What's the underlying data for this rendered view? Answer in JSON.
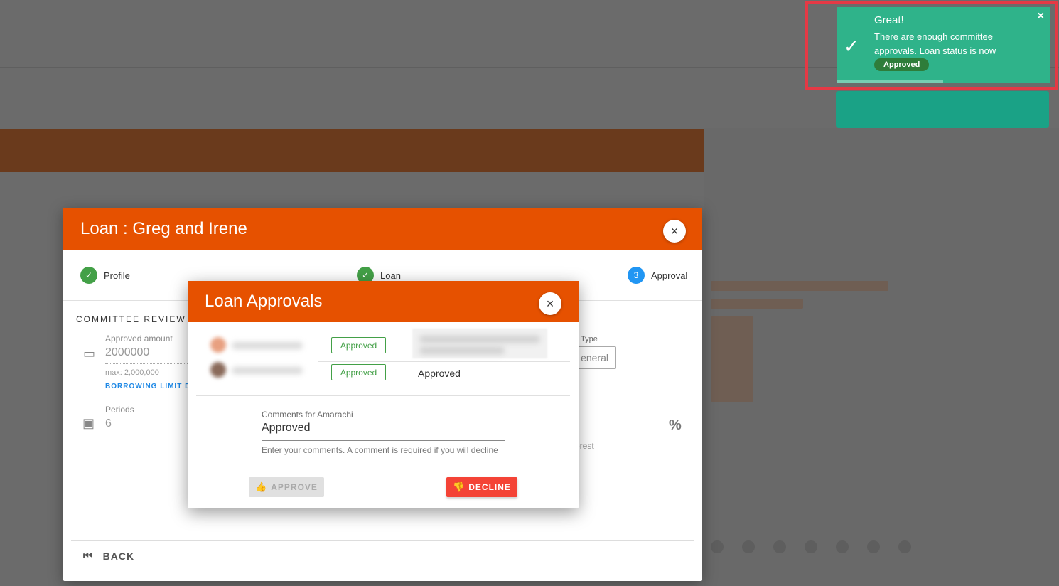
{
  "toast": {
    "title": "Great!",
    "message": "There are enough committee approvals. Loan status is now",
    "badge": "Approved",
    "close_icon": "×",
    "check_icon": "✓",
    "color": "#2fb38a"
  },
  "loan_modal": {
    "title": "Loan : Greg and Irene",
    "close_icon": "×",
    "steps": [
      {
        "label": "Profile",
        "state": "done",
        "icon": "✓"
      },
      {
        "label": "Loan",
        "state": "done",
        "icon": "✓"
      },
      {
        "label": "Approval",
        "state": "active",
        "number": "3"
      }
    ],
    "section_title": "COMMITTEE REVIEW A",
    "approved_amount": {
      "label": "Approved amount",
      "value": "2000000",
      "hint": "max: 2,000,000",
      "link": "BORROWING LIMIT DET"
    },
    "periods": {
      "label": "Periods",
      "value": "6"
    },
    "type_label": "Type",
    "type_value": "eneral",
    "interest_label": "erest",
    "percent_icon": "%",
    "back_label": "BACK",
    "back_icon": "⏮"
  },
  "approvals": {
    "title": "Loan Approvals",
    "close_icon": "×",
    "rows": [
      {
        "status": "Approved",
        "comment": ""
      },
      {
        "status": "Approved",
        "comment": "Approved"
      }
    ],
    "comment_label": "Comments for Amarachi",
    "comment_value": "Approved",
    "comment_hint": "Enter your comments. A comment is required if you will decline",
    "approve_label": "APPROVE",
    "decline_label": "DECLINE",
    "approve_icon": "👍",
    "decline_icon": "👎",
    "accent": "#e65100",
    "decline_color": "#f44336"
  }
}
